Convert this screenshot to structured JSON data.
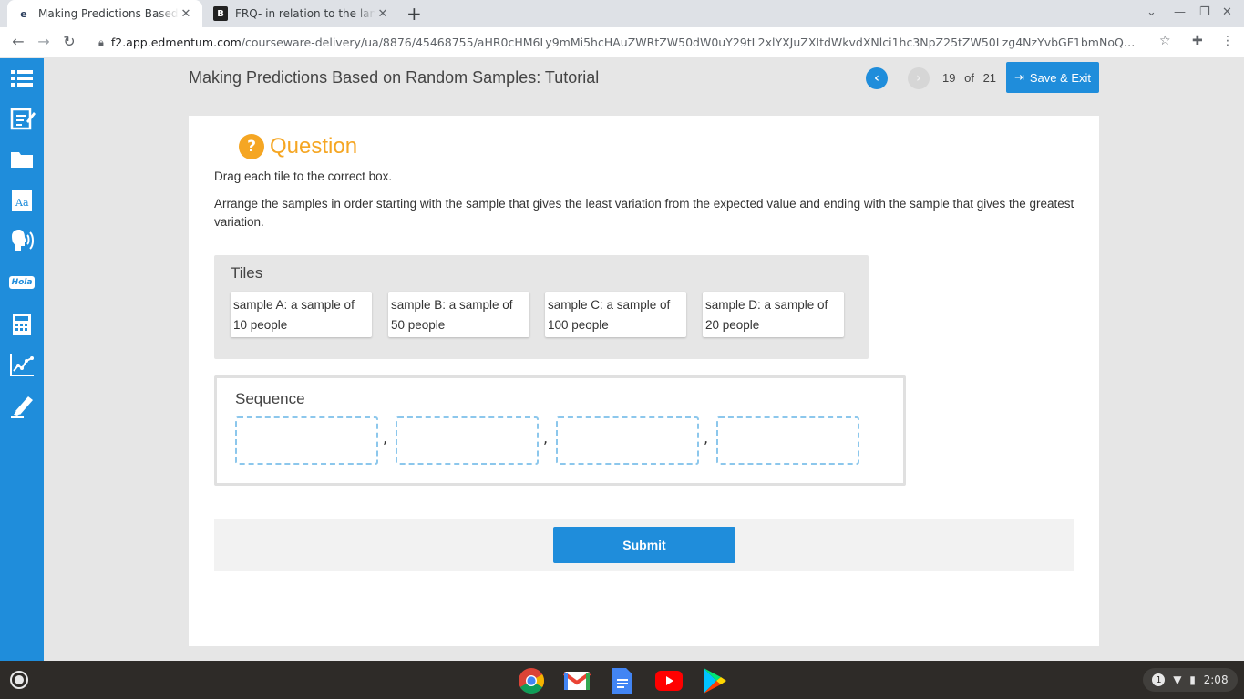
{
  "browser": {
    "tabs": [
      {
        "title": "Making Predictions Based on Random Samples: Tutorial",
        "favicon": "edmentum-e-icon",
        "active": true
      },
      {
        "title": "FRQ- in relation to the land size of",
        "favicon": "b-icon",
        "active": false
      }
    ],
    "url_host": "f2.app.edmentum.com",
    "url_path": "/courseware-delivery/ua/8876/45468755/aHR0cHM6Ly9mMi5hcHAuZWRtZW50dW0uY29tL2xlYXJuZXItdWkvdXNlci1hc3NpZ25tZW50Lzg4NzYvbGF1bmNoQGFkLzQ1NDY4NzU..."
  },
  "header": {
    "lesson_title": "Making Predictions Based on Random Samples: Tutorial",
    "current_page": "19",
    "of_label": "of",
    "total_pages": "21",
    "save_exit_label": "Save & Exit"
  },
  "sidebar": {
    "items": [
      "menu-list-icon",
      "notepad-icon",
      "folder-icon",
      "dictionary-icon",
      "text-to-speech-icon",
      "translate-hola-icon",
      "calculator-icon",
      "graph-icon",
      "highlighter-icon"
    ],
    "hola_label": "Hola"
  },
  "question": {
    "heading": "Question",
    "instruction": "Drag each tile to the correct box.",
    "prompt": "Arrange the samples in order starting with the sample that gives the least variation from the expected value and ending with the sample that gives the greatest variation.",
    "tiles_label": "Tiles",
    "tiles": [
      "sample A: a sample of 10 people",
      "sample B: a sample of 50 people",
      "sample C: a sample of 100 people",
      "sample D: a sample of 20 people"
    ],
    "sequence_label": "Sequence",
    "separator": ",",
    "submit_label": "Submit"
  },
  "shelf": {
    "apps": [
      "chrome-icon",
      "gmail-icon",
      "docs-icon",
      "youtube-icon",
      "play-store-icon"
    ],
    "notification_count": "1",
    "time": "2:08"
  },
  "colors": {
    "accent": "#1f8ddb",
    "question_orange": "#f5a623",
    "slot_border": "#8cc7ec"
  }
}
